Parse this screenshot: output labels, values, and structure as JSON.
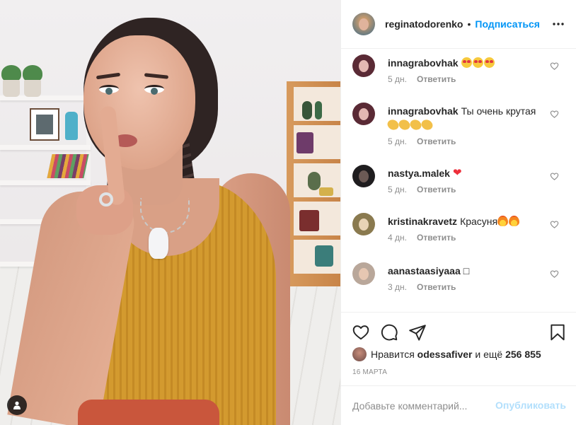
{
  "post": {
    "author": "reginatodorenko",
    "follow_label": "Подписаться",
    "separator": "•"
  },
  "comments": [
    {
      "user": "innagrabovhak",
      "text": "",
      "emoji": [
        "hearteyes",
        "hearteyes",
        "hearteyes"
      ],
      "time": "5 дн.",
      "reply": "Ответить",
      "avatar_colors": [
        "#5a2a35",
        "#e3b7b2"
      ]
    },
    {
      "user": "innagrabovhak",
      "text": "Ты очень крутая",
      "emoji": [
        "clap",
        "clap",
        "clap",
        "clap"
      ],
      "time": "5 дн.",
      "reply": "Ответить",
      "avatar_colors": [
        "#5a2a35",
        "#e3b7b2"
      ]
    },
    {
      "user": "nastya.malek",
      "text": "",
      "emoji": [
        "heart"
      ],
      "time": "5 дн.",
      "reply": "Ответить",
      "avatar_colors": [
        "#1f1d1f",
        "#6b5a55"
      ]
    },
    {
      "user": "kristinakravetz",
      "text": "Красуня",
      "emoji": [
        "fire",
        "fire"
      ],
      "time": "4 дн.",
      "reply": "Ответить",
      "avatar_colors": [
        "#8a7a4f",
        "#e8d3b5"
      ]
    },
    {
      "user": "aanastaasiyaaa",
      "text": "□",
      "emoji": [],
      "time": "3 дн.",
      "reply": "Ответить",
      "avatar_colors": [
        "#b9a79a",
        "#e6c7b2"
      ]
    }
  ],
  "likes": {
    "prefix": "Нравится",
    "user": "odessafiver",
    "and": "и ещё",
    "count": "256 855"
  },
  "date": "16 МАРТА",
  "add_comment": {
    "placeholder": "Добавьте комментарий...",
    "publish_label": "Опубликовать"
  },
  "icons": {
    "like": "heart-outline-icon",
    "comment": "speech-bubble-icon",
    "share": "paper-plane-icon",
    "save": "bookmark-icon",
    "more": "ellipsis-icon",
    "user_tag": "person-icon"
  },
  "colors": {
    "link_blue": "#0095f6",
    "publish_disabled": "#b2dffc",
    "muted": "#8e8e8e",
    "text": "#262626",
    "border": "#efefef"
  }
}
